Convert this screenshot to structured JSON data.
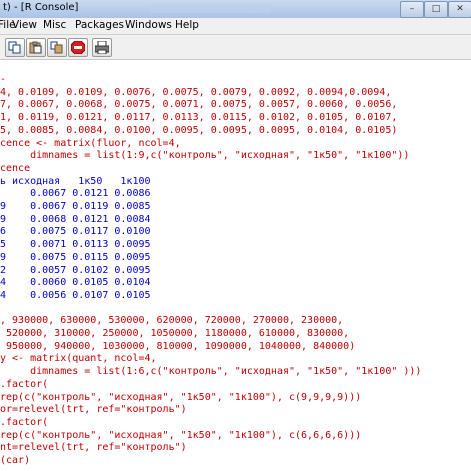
{
  "window": {
    "title": "t) - [R Console]"
  },
  "menubar": {
    "items": [
      "File",
      "View",
      "Misc",
      "Packages",
      "Windows",
      "Help"
    ]
  },
  "toolbar": {
    "buttons": [
      "copy-icon",
      "paste-icon",
      "copy-paste-icon",
      "stop-icon",
      "print-icon"
    ]
  },
  "console": {
    "lines": [
      {
        "text": "-",
        "kind": "in"
      },
      {
        "text": "4, 0.0109, 0.0109, 0.0076, 0.0075, 0.0079, 0.0092, 0.0094,0.0094,",
        "kind": "in"
      },
      {
        "text": "7, 0.0067, 0.0068, 0.0075, 0.0071, 0.0075, 0.0057, 0.0060, 0.0056,",
        "kind": "in"
      },
      {
        "text": "1, 0.0119, 0.0121, 0.0117, 0.0113, 0.0115, 0.0102, 0.0105, 0.0107,",
        "kind": "in"
      },
      {
        "text": "5, 0.0085, 0.0084, 0.0100, 0.0095, 0.0095, 0.0095, 0.0104, 0.0105)",
        "kind": "in"
      },
      {
        "text": "cence <- matrix(fluor, ncol=4,",
        "kind": "in"
      },
      {
        "text": "     dimnames = list(1:9,c(\"контроль\", \"исходная\", \"1к50\", \"1к100\"))",
        "kind": "in"
      },
      {
        "text": "cence",
        "kind": "in"
      },
      {
        "text": "ь исходная   1к50   1к100",
        "kind": "out"
      },
      {
        "text": "     0.0067 0.0121 0.0086",
        "kind": "out"
      },
      {
        "text": "9    0.0067 0.0119 0.0085",
        "kind": "out"
      },
      {
        "text": "9    0.0068 0.0121 0.0084",
        "kind": "out"
      },
      {
        "text": "6    0.0075 0.0117 0.0100",
        "kind": "out"
      },
      {
        "text": "5    0.0071 0.0113 0.0095",
        "kind": "out"
      },
      {
        "text": "9    0.0075 0.0115 0.0095",
        "kind": "out"
      },
      {
        "text": "2    0.0057 0.0102 0.0095",
        "kind": "out"
      },
      {
        "text": "4    0.0060 0.0105 0.0104",
        "kind": "out"
      },
      {
        "text": "4    0.0056 0.0107 0.0105",
        "kind": "out"
      },
      {
        "text": "",
        "kind": "in"
      },
      {
        "text": ", 930000, 630000, 530000, 620000, 720000, 270000, 230000,",
        "kind": "in"
      },
      {
        "text": " 520000, 310000, 250000, 1050000, 1180000, 610000, 830000,",
        "kind": "in"
      },
      {
        "text": " 950000, 940000, 1030000, 810000, 1090000, 1040000, 840000)",
        "kind": "in"
      },
      {
        "text": "y <- matrix(quant, ncol=4,",
        "kind": "in"
      },
      {
        "text": "     dimnames = list(1:6,c(\"контроль\", \"исходная\", \"1к50\", \"1к100\" )))",
        "kind": "in"
      },
      {
        "text": ".factor(",
        "kind": "in"
      },
      {
        "text": "rep(c(\"контроль\", \"исходная\", \"1к50\", \"1к100\"), c(9,9,9,9)))",
        "kind": "in"
      },
      {
        "text": "or=relevel(trt, ref=\"контроль\")",
        "kind": "in"
      },
      {
        "text": ".factor(",
        "kind": "in"
      },
      {
        "text": "rep(c(\"контроль\", \"исходная\", \"1к50\", \"1к100\"), c(6,6,6,6)))",
        "kind": "in"
      },
      {
        "text": "nt=relevel(trt, ref=\"контроль\")",
        "kind": "in"
      },
      {
        "text": "(car)",
        "kind": "in"
      }
    ]
  },
  "colors": {
    "input": "#c00000",
    "output": "#0000cc",
    "titlebar": "#b8cde9"
  }
}
